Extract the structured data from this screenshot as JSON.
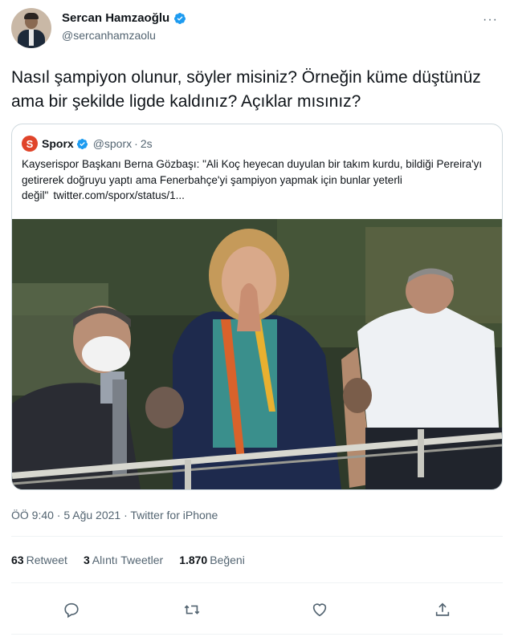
{
  "author": {
    "name": "Sercan Hamzaoğlu",
    "handle": "@sercanhamzaolu",
    "verified": true
  },
  "more_icon": "more-horizontal-icon",
  "tweet": {
    "text": "Nasıl şampiyon olunur, söyler misiniz? Örneğin küme düştünüz ama bir şekilde ligde kaldınız? Açıklar mısınız?"
  },
  "quote": {
    "name": "Sporx",
    "handle": "@sporx",
    "separator": "·",
    "time": "2s",
    "text": "Kayserispor Başkanı Berna Gözbaşı: \"Ali Koç heyecan duyulan bir takım kurdu, bildiği Pereira'yı getirerek doğruyu yaptı ama Fenerbahçe'yi şampiyon yapmak için bunlar yeterli değil\"",
    "link": "twitter.com/sporx/status/1...",
    "logo_color": "#e0442a"
  },
  "meta": {
    "text": "ÖÖ 9:40 · 5 Ağu 2021 · Twitter for iPhone"
  },
  "stats": {
    "retweets_count": "63",
    "retweets_label": "Retweet",
    "quotes_count": "3",
    "quotes_label": "Alıntı Tweetler",
    "likes_count": "1.870",
    "likes_label": "Beğeni"
  },
  "actions": [
    "reply-icon",
    "retweet-icon",
    "like-icon",
    "share-icon"
  ],
  "colors": {
    "verified": "#1d9bf0",
    "secondary_text": "#536471",
    "border": "#cfd9de"
  }
}
